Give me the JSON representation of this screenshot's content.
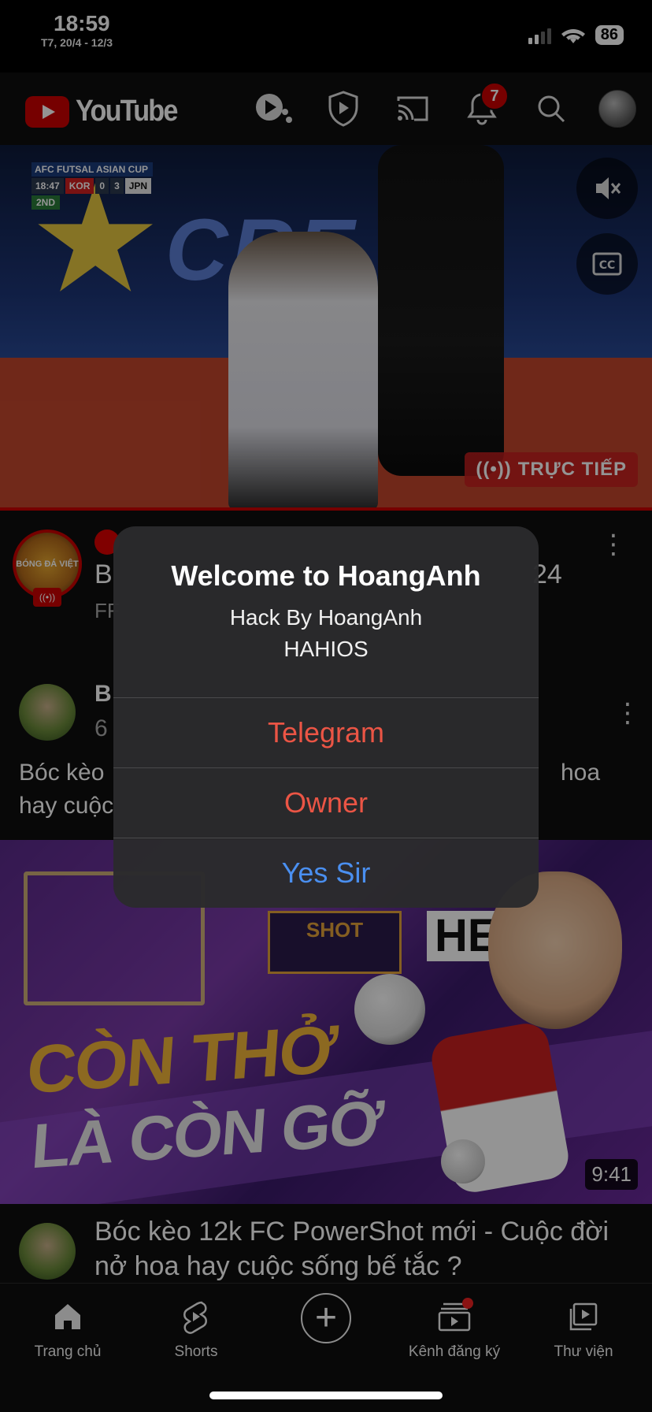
{
  "status_bar": {
    "time": "18:59",
    "date": "T7, 20/4 - 12/3",
    "battery": "86"
  },
  "app_bar": {
    "logo_text": "YouTube",
    "notification_count": "7"
  },
  "player": {
    "scorebug": {
      "competition": "AFC FUTSAL ASIAN CUP",
      "clock": "18:47",
      "home": "KOR",
      "home_score": "0",
      "away_score": "3",
      "away": "JPN",
      "period": "2ND"
    },
    "live_label": "TRỰC TIẾP"
  },
  "feed": {
    "item1": {
      "avatar_text": "BÓNG ĐÁ VIỆT",
      "title_start": "B",
      "title_end": "24",
      "subtitle": "FF"
    },
    "item2": {
      "channel_initial": "B",
      "meta_start": "6",
      "desc_line1": "Bóc kèo",
      "desc_line1_end": "hoa",
      "desc_line2": "hay cuộc"
    },
    "thumbnail": {
      "headline1": "CÒN THỞ",
      "headline2": "LÀ CÒN GỠ",
      "logo_text": "SHOT",
      "he_text": "HE HE",
      "duration": "9:41"
    },
    "item3": {
      "title_line1": "Bóc kèo 12k FC PowerShot mới - Cuộc đời",
      "title_line2": "nở hoa hay cuộc sống bế tắc ?"
    }
  },
  "bottom_nav": {
    "home": "Trang chủ",
    "shorts": "Shorts",
    "subscriptions": "Kênh đăng ký",
    "library": "Thư viện"
  },
  "alert": {
    "title": "Welcome to HoangAnh",
    "message_line1": "Hack By HoangAnh",
    "message_line2": "HAHIOS",
    "buttons": [
      "Telegram",
      "Owner",
      "Yes Sir"
    ],
    "colors": {
      "destructive": "#eb5545",
      "default": "#4a8ff0"
    }
  }
}
